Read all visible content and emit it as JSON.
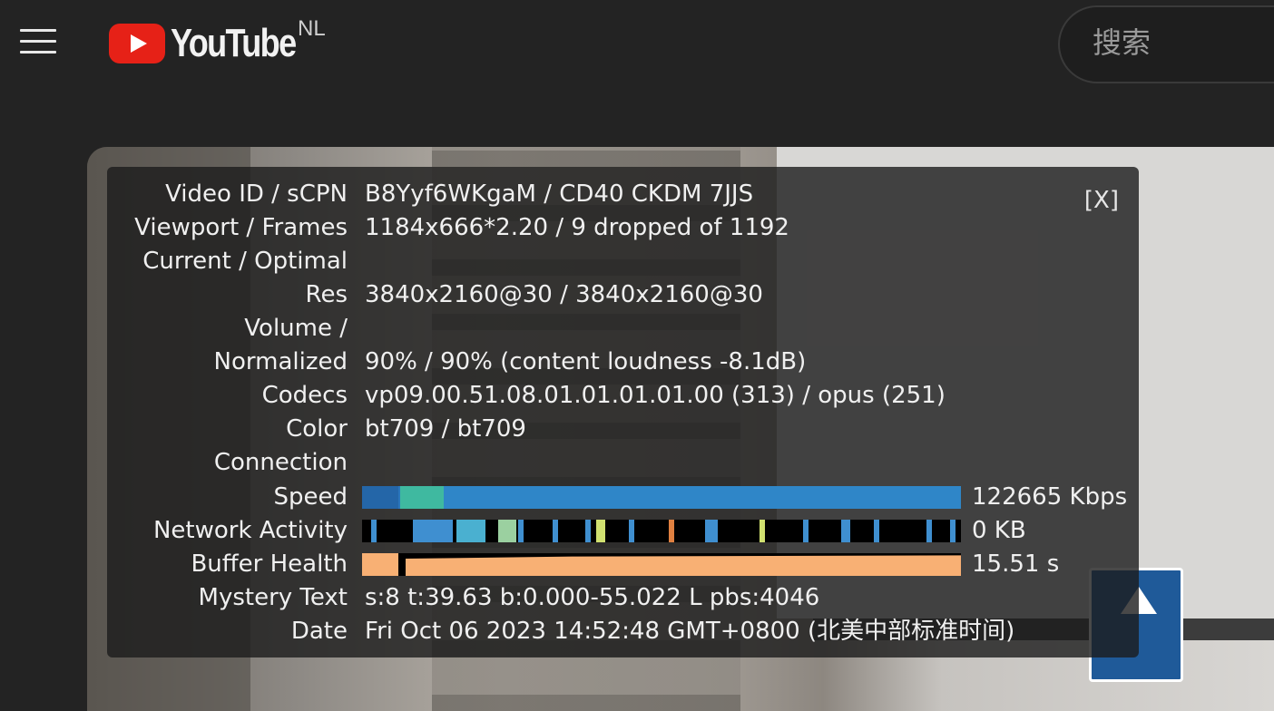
{
  "header": {
    "logo_text": "YouTube",
    "region": "NL",
    "search_placeholder": "搜索"
  },
  "stats": {
    "close_label": "[X]",
    "rows": [
      {
        "label": "Video ID / sCPN",
        "value": "B8Yyf6WKgaM / CD40 CKDM 7JJS"
      },
      {
        "label": "Viewport / Frames",
        "value": "1184x666*2.20 / 9 dropped of 1192"
      },
      {
        "label": "Current / Optimal",
        "value": ""
      },
      {
        "label": "Res",
        "value": "3840x2160@30 / 3840x2160@30"
      },
      {
        "label": "Volume /",
        "value": ""
      },
      {
        "label": "Normalized",
        "value": "90% / 90% (content loudness -8.1dB)"
      },
      {
        "label": "Codecs",
        "value": "vp09.00.51.08.01.01.01.01.00 (313) / opus (251)"
      },
      {
        "label": "Color",
        "value": "bt709 / bt709"
      },
      {
        "label": "Connection",
        "value": ""
      },
      {
        "label": "Speed",
        "value": "122665 Kbps"
      },
      {
        "label": "Network Activity",
        "value": "0 KB"
      },
      {
        "label": "Buffer Health",
        "value": "15.51 s"
      },
      {
        "label": "Mystery Text",
        "value": "s:8 t:39.63 b:0.000-55.022 L pbs:4046"
      },
      {
        "label": "Date",
        "value": "Fri Oct 06 2023 14:52:48 GMT+0800 (北美中部标准时间)"
      }
    ]
  },
  "colors": {
    "speed": "#2a76bc",
    "network": "#3f8fd0",
    "buffer": "#f8b074"
  }
}
